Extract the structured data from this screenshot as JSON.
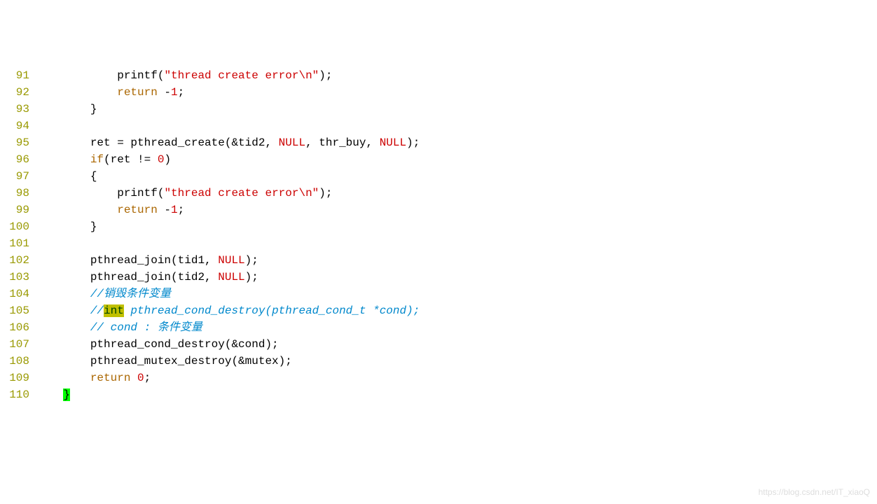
{
  "watermark": "https://blog.csdn.net/IT_xiaoQ",
  "lines": [
    {
      "n": "91",
      "tokens": [
        {
          "t": "            printf(",
          "c": ""
        },
        {
          "t": "\"thread create error",
          "c": "tok-string"
        },
        {
          "t": "\\n",
          "c": "tok-escape"
        },
        {
          "t": "\"",
          "c": "tok-string"
        },
        {
          "t": ");",
          "c": ""
        }
      ]
    },
    {
      "n": "92",
      "tokens": [
        {
          "t": "            ",
          "c": ""
        },
        {
          "t": "return",
          "c": "tok-keyword"
        },
        {
          "t": " -",
          "c": ""
        },
        {
          "t": "1",
          "c": "tok-number"
        },
        {
          "t": ";",
          "c": ""
        }
      ]
    },
    {
      "n": "93",
      "tokens": [
        {
          "t": "        }",
          "c": ""
        }
      ]
    },
    {
      "n": "94",
      "tokens": []
    },
    {
      "n": "95",
      "tokens": [
        {
          "t": "        ret = pthread_create(&tid2, ",
          "c": ""
        },
        {
          "t": "NULL",
          "c": "tok-const"
        },
        {
          "t": ", thr_buy, ",
          "c": ""
        },
        {
          "t": "NULL",
          "c": "tok-const"
        },
        {
          "t": ");",
          "c": ""
        }
      ]
    },
    {
      "n": "96",
      "tokens": [
        {
          "t": "        ",
          "c": ""
        },
        {
          "t": "if",
          "c": "tok-keyword"
        },
        {
          "t": "(ret != ",
          "c": ""
        },
        {
          "t": "0",
          "c": "tok-number"
        },
        {
          "t": ")",
          "c": ""
        }
      ]
    },
    {
      "n": "97",
      "tokens": [
        {
          "t": "        {",
          "c": ""
        }
      ]
    },
    {
      "n": "98",
      "tokens": [
        {
          "t": "            printf(",
          "c": ""
        },
        {
          "t": "\"thread create error",
          "c": "tok-string"
        },
        {
          "t": "\\n",
          "c": "tok-escape"
        },
        {
          "t": "\"",
          "c": "tok-string"
        },
        {
          "t": ");",
          "c": ""
        }
      ]
    },
    {
      "n": "99",
      "tokens": [
        {
          "t": "            ",
          "c": ""
        },
        {
          "t": "return",
          "c": "tok-keyword"
        },
        {
          "t": " -",
          "c": ""
        },
        {
          "t": "1",
          "c": "tok-number"
        },
        {
          "t": ";",
          "c": ""
        }
      ]
    },
    {
      "n": "100",
      "tokens": [
        {
          "t": "        }",
          "c": ""
        }
      ]
    },
    {
      "n": "101",
      "tokens": []
    },
    {
      "n": "102",
      "tokens": [
        {
          "t": "        pthread_join(tid1, ",
          "c": ""
        },
        {
          "t": "NULL",
          "c": "tok-const"
        },
        {
          "t": ");",
          "c": ""
        }
      ]
    },
    {
      "n": "103",
      "tokens": [
        {
          "t": "        pthread_join(tid2, ",
          "c": ""
        },
        {
          "t": "NULL",
          "c": "tok-const"
        },
        {
          "t": ");",
          "c": ""
        }
      ]
    },
    {
      "n": "104",
      "tokens": [
        {
          "t": "        ",
          "c": ""
        },
        {
          "t": "//销毁条件变量",
          "c": "tok-comment"
        }
      ]
    },
    {
      "n": "105",
      "tokens": [
        {
          "t": "        ",
          "c": ""
        },
        {
          "t": "//",
          "c": "tok-comment"
        },
        {
          "t": "int",
          "c": "tok-type-hl"
        },
        {
          "t": " pthread_cond_destroy(pthread_cond_t *cond);",
          "c": "tok-comment"
        }
      ]
    },
    {
      "n": "106",
      "tokens": [
        {
          "t": "        ",
          "c": ""
        },
        {
          "t": "// cond : 条件变量",
          "c": "tok-comment"
        }
      ]
    },
    {
      "n": "107",
      "tokens": [
        {
          "t": "        pthread_cond_destroy(&cond);",
          "c": ""
        }
      ]
    },
    {
      "n": "108",
      "tokens": [
        {
          "t": "        pthread_mutex_destroy(&mutex);",
          "c": ""
        }
      ]
    },
    {
      "n": "109",
      "tokens": [
        {
          "t": "        ",
          "c": ""
        },
        {
          "t": "return",
          "c": "tok-keyword"
        },
        {
          "t": " ",
          "c": ""
        },
        {
          "t": "0",
          "c": "tok-number"
        },
        {
          "t": ";",
          "c": ""
        }
      ]
    },
    {
      "n": "110",
      "tokens": [
        {
          "t": "    ",
          "c": ""
        },
        {
          "t": "}",
          "c": "cursor-brace"
        }
      ]
    }
  ]
}
